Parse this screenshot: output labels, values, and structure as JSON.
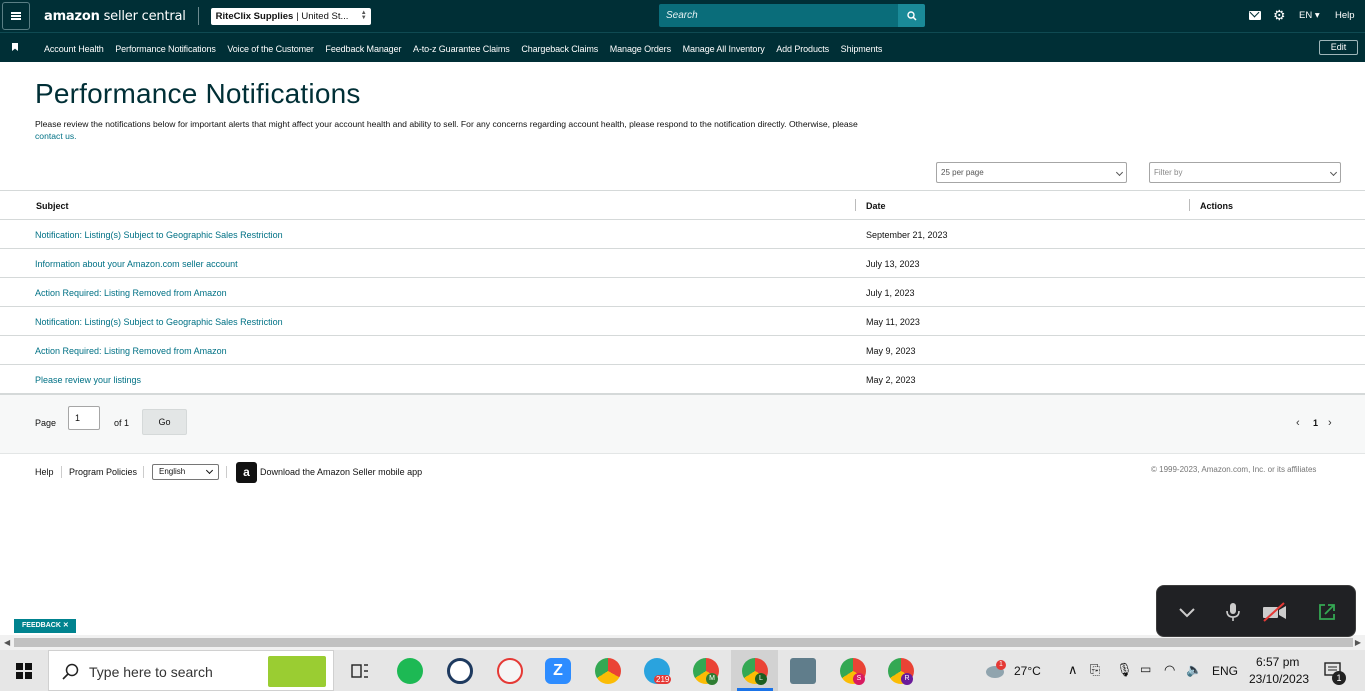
{
  "header": {
    "logo_text_bold": "amazon",
    "logo_text": " seller central",
    "store_name": "RiteClix Supplies",
    "store_region": "| United St...",
    "search_placeholder": "Search",
    "language": "EN ▾",
    "help": "Help"
  },
  "nav": {
    "items": [
      "Account Health",
      "Performance Notifications",
      "Voice of the Customer",
      "Feedback Manager",
      "A-to-z Guarantee Claims",
      "Chargeback Claims",
      "Manage Orders",
      "Manage All Inventory",
      "Add Products",
      "Shipments"
    ],
    "edit": "Edit"
  },
  "page": {
    "title": "Performance Notifications",
    "description": "Please review the notifications below for important alerts that might affect your account health and ability to sell. For any concerns regarding account health, please respond to the notification directly. Otherwise, please ",
    "contact_link": "contact us",
    "period": "."
  },
  "controls": {
    "per_page": "25 per page",
    "filter_placeholder": "Filter by"
  },
  "table": {
    "headers": {
      "subject": "Subject",
      "date": "Date",
      "actions": "Actions"
    },
    "rows": [
      {
        "subject": "Notification: Listing(s) Subject to Geographic Sales Restriction",
        "date": "September 21, 2023"
      },
      {
        "subject": "Information about your Amazon.com seller account",
        "date": "July 13, 2023"
      },
      {
        "subject": "Action Required: Listing Removed from Amazon",
        "date": "July 1, 2023"
      },
      {
        "subject": "Notification: Listing(s) Subject to Geographic Sales Restriction",
        "date": "May 11, 2023"
      },
      {
        "subject": "Action Required: Listing Removed from Amazon",
        "date": "May 9, 2023"
      },
      {
        "subject": "Please review your listings",
        "date": "May 2, 2023"
      }
    ]
  },
  "pagination": {
    "page_label": "Page",
    "page_value": "1",
    "of_label": "of 1",
    "go": "Go",
    "current": "1"
  },
  "footer": {
    "help": "Help",
    "policies": "Program Policies",
    "language": "English",
    "app_icon_letter": "a",
    "app_text": "Download the Amazon Seller mobile app",
    "copyright": "© 1999-2023, Amazon.com, Inc. or its affiliates"
  },
  "feedback": "FEEDBACK ✕",
  "taskbar": {
    "search_placeholder": "Type here to search",
    "badge_telegram": "219",
    "chrome_m": "M",
    "chrome_l": "L",
    "chrome_s": "S",
    "chrome_r": "R",
    "weather_badge": "1",
    "temperature": "27°C",
    "lang": "ENG",
    "time": "6:57 pm",
    "date": "23/10/2023",
    "notif_count": "1"
  }
}
